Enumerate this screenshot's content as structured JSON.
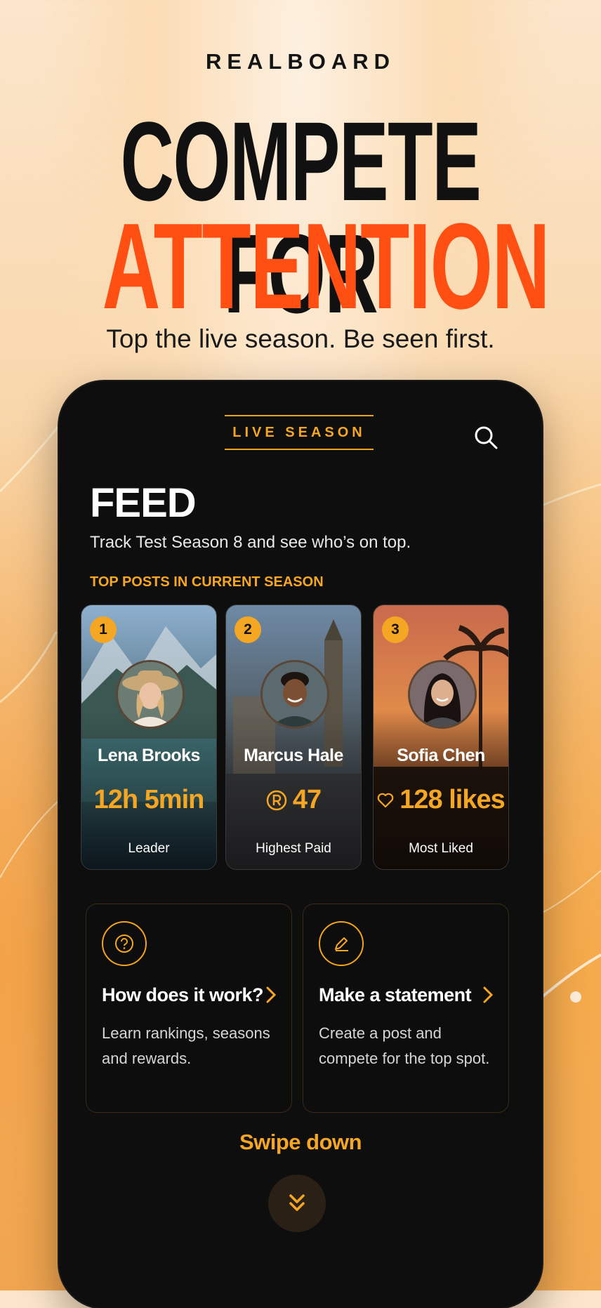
{
  "brand": "REALBOARD",
  "hero": {
    "line1": "COMPETE FOR",
    "line2": "ATTENTION",
    "tagline": "Top the live season. Be seen first."
  },
  "app": {
    "season_badge": "LIVE SEASON",
    "feed_title": "FEED",
    "feed_subtitle": "Track Test Season 8 and see who’s on top.",
    "section_label": "TOP POSTS IN CURRENT SEASON",
    "top_posts": [
      {
        "rank": "1",
        "name": "Lena Brooks",
        "value": "12h 5min",
        "value_icon": "",
        "label": "Leader"
      },
      {
        "rank": "2",
        "name": "Marcus Hale",
        "value": "47",
        "value_icon": "registered-coin-icon",
        "label": "Highest Paid"
      },
      {
        "rank": "3",
        "name": "Sofia Chen",
        "value": "128 likes",
        "value_icon": "heart-icon",
        "label": "Most Liked"
      }
    ],
    "info_cards": [
      {
        "title": "How does it work?",
        "description": "Learn rankings, seasons and rewards.",
        "icon": "question-icon"
      },
      {
        "title": "Make a statement",
        "description": "Create a post and compete for the top spot.",
        "icon": "pencil-icon"
      }
    ],
    "swipe_label": "Swipe down"
  },
  "colors": {
    "accent": "#f5a623",
    "headline_orange": "#ff4f12",
    "phone_bg": "#0e0e0f"
  }
}
